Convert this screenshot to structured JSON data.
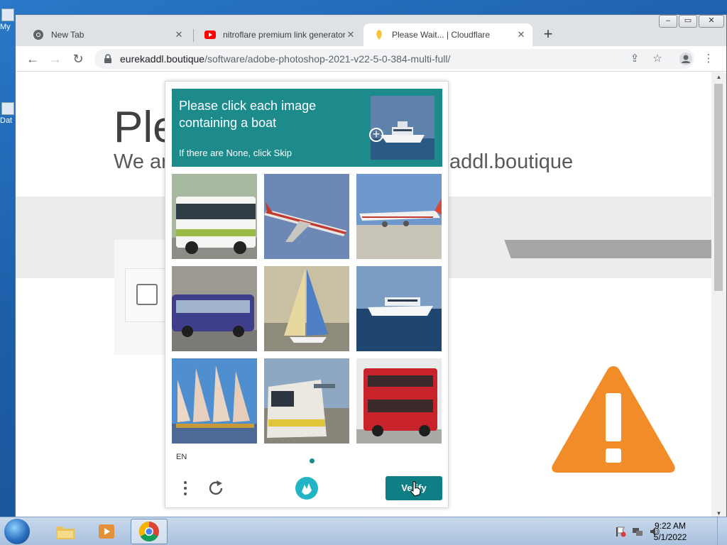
{
  "desktop": {
    "icons": [
      "My",
      "Dat"
    ]
  },
  "browser": {
    "tabs": [
      {
        "title": "New Tab",
        "icon": "chrome-icon",
        "active": false
      },
      {
        "title": "nitroflare premium link generator",
        "icon": "youtube-icon",
        "active": false
      },
      {
        "title": "Please Wait... | Cloudflare",
        "icon": "cloudflare-icon",
        "active": true
      }
    ],
    "address": {
      "host": "eurekaddl.boutique",
      "path": "/software/adobe-photoshop-2021-v22-5-0-384-multi-full/"
    },
    "window_controls": [
      "–",
      "▭",
      "✕"
    ]
  },
  "page": {
    "heading": "Ple",
    "subheading": "We ar",
    "host_fragment": "addl.boutique",
    "accent": "#f38020"
  },
  "captcha": {
    "prompt": "Please click each image containing a boat",
    "hint": "If there are None, click Skip",
    "language": "EN",
    "verify_label": "Verify",
    "accent": "#1d8a8c",
    "tiles": [
      {
        "subject": "bus"
      },
      {
        "subject": "airplane"
      },
      {
        "subject": "airplane"
      },
      {
        "subject": "bus"
      },
      {
        "subject": "sailboat"
      },
      {
        "subject": "yacht"
      },
      {
        "subject": "sailing-ship"
      },
      {
        "subject": "train"
      },
      {
        "subject": "double-decker-bus"
      }
    ]
  },
  "taskbar": {
    "time": "9:22 AM",
    "date": "5/1/2022"
  }
}
